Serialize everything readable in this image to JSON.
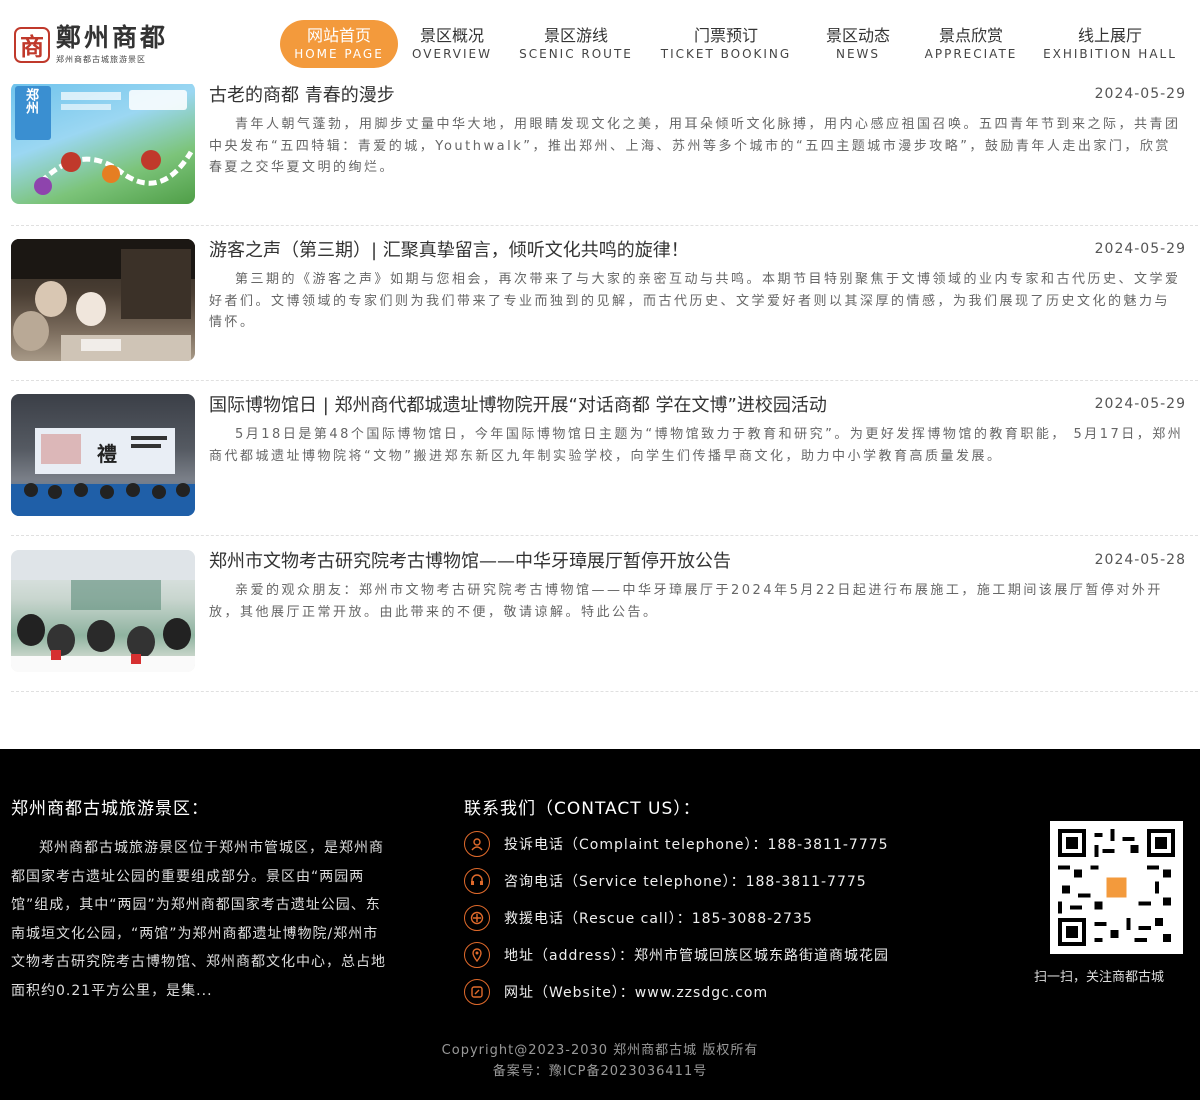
{
  "header": {
    "logo_seal": "商",
    "logo_main": "鄭州商都",
    "logo_sub": "郑州商都古城旅游景区",
    "nav": [
      {
        "zh": "网站首页",
        "en": "HOME PAGE",
        "active": true
      },
      {
        "zh": "景区概况",
        "en": "OVERVIEW"
      },
      {
        "zh": "景区游线",
        "en": "SCENIC ROUTE"
      },
      {
        "zh": "门票预订",
        "en": "TICKET BOOKING"
      },
      {
        "zh": "景区动态",
        "en": "NEWS"
      },
      {
        "zh": "景点欣赏",
        "en": "APPRECIATE"
      },
      {
        "zh": "线上展厅",
        "en": "EXHIBITION HALL"
      }
    ]
  },
  "news": [
    {
      "title": "古老的商都 青春的漫步",
      "date": "2024-05-29",
      "summary": "青年人朝气蓬勃，用脚步丈量中华大地，用眼睛发现文化之美，用耳朵倾听文化脉搏，用内心感应祖国召唤。五四青年节到来之际，共青团中央发布“五四特辑：青爱的城，Youthwalk”，推出郑州、上海、苏州等多个城市的“五四主题城市漫步攻略”，鼓励青年人走出家门，欣赏春夏之交华夏文明的绚烂。",
      "thumb_text": "郑州"
    },
    {
      "title": "游客之声（第三期）| 汇聚真挚留言，倾听文化共鸣的旋律！",
      "date": "2024-05-29",
      "summary": "第三期的《游客之声》如期与您相会，再次带来了与大家的亲密互动与共鸣。本期节目特别聚焦于文博领域的业内专家和古代历史、文学爱好者们。文博领域的专家们则为我们带来了专业而独到的见解，而古代历史、文学爱好者则以其深厚的情感，为我们展现了历史文化的魅力与情怀。"
    },
    {
      "title": "国际博物馆日 | 郑州商代都城遗址博物院开展“对话商都 学在文博”进校园活动",
      "date": "2024-05-29",
      "summary": "5月18日是第48个国际博物馆日，今年国际博物馆日主题为“博物馆致力于教育和研究”。为更好发挥博物馆的教育职能， 5月17日，郑州商代都城遗址博物院将“文物”搬进郑东新区九年制实验学校，向学生们传播早商文化，助力中小学教育高质量发展。",
      "thumb_text": "禮"
    },
    {
      "title": "郑州市文物考古研究院考古博物馆——中华牙璋展厅暂停开放公告",
      "date": "2024-05-28",
      "summary": "亲爱的观众朋友：郑州市文物考古研究院考古博物馆——中华牙璋展厅于2024年5月22日起进行布展施工，施工期间该展厅暂停对外开放，其他展厅正常开放。由此带来的不便，敬请谅解。特此公告。"
    }
  ],
  "footer": {
    "about_title": "郑州商都古城旅游景区：",
    "about_text": "郑州商都古城旅游景区位于郑州市管城区，是郑州商都国家考古遗址公园的重要组成部分。景区由“两园两馆”组成，其中“两园”为郑州商都国家考古遗址公园、东南城垣文化公园，“两馆”为郑州商都遗址博物院/郑州市文物考古研究院考古博物馆、郑州商都文化中心，总占地面积约0.21平方公里，是集...",
    "contact_title": "联系我们（CONTACT US）：",
    "contacts": [
      {
        "label": "投诉电话（Complaint telephone）：188-3811-7775",
        "icon": "complaint-icon"
      },
      {
        "label": "咨询电话（Service telephone）：188-3811-7775",
        "icon": "headset-icon"
      },
      {
        "label": "救援电话（Rescue call）：185-3088-2735",
        "icon": "rescue-icon"
      },
      {
        "label": "地址（address）：郑州市管城回族区城东路街道商城花园",
        "icon": "location-icon"
      },
      {
        "label": "网址（Website）：www.zzsdgc.com",
        "icon": "website-icon"
      }
    ],
    "qr_caption": "扫一扫，关注商都古城",
    "copyright": "Copyright@2023-2030 郑州商都古城 版权所有",
    "icp": "备案号：豫ICP备2023036411号"
  },
  "colors": {
    "accent": "#f39a3c",
    "icon_orange": "#e06a2b",
    "footer_bg": "#000000"
  }
}
